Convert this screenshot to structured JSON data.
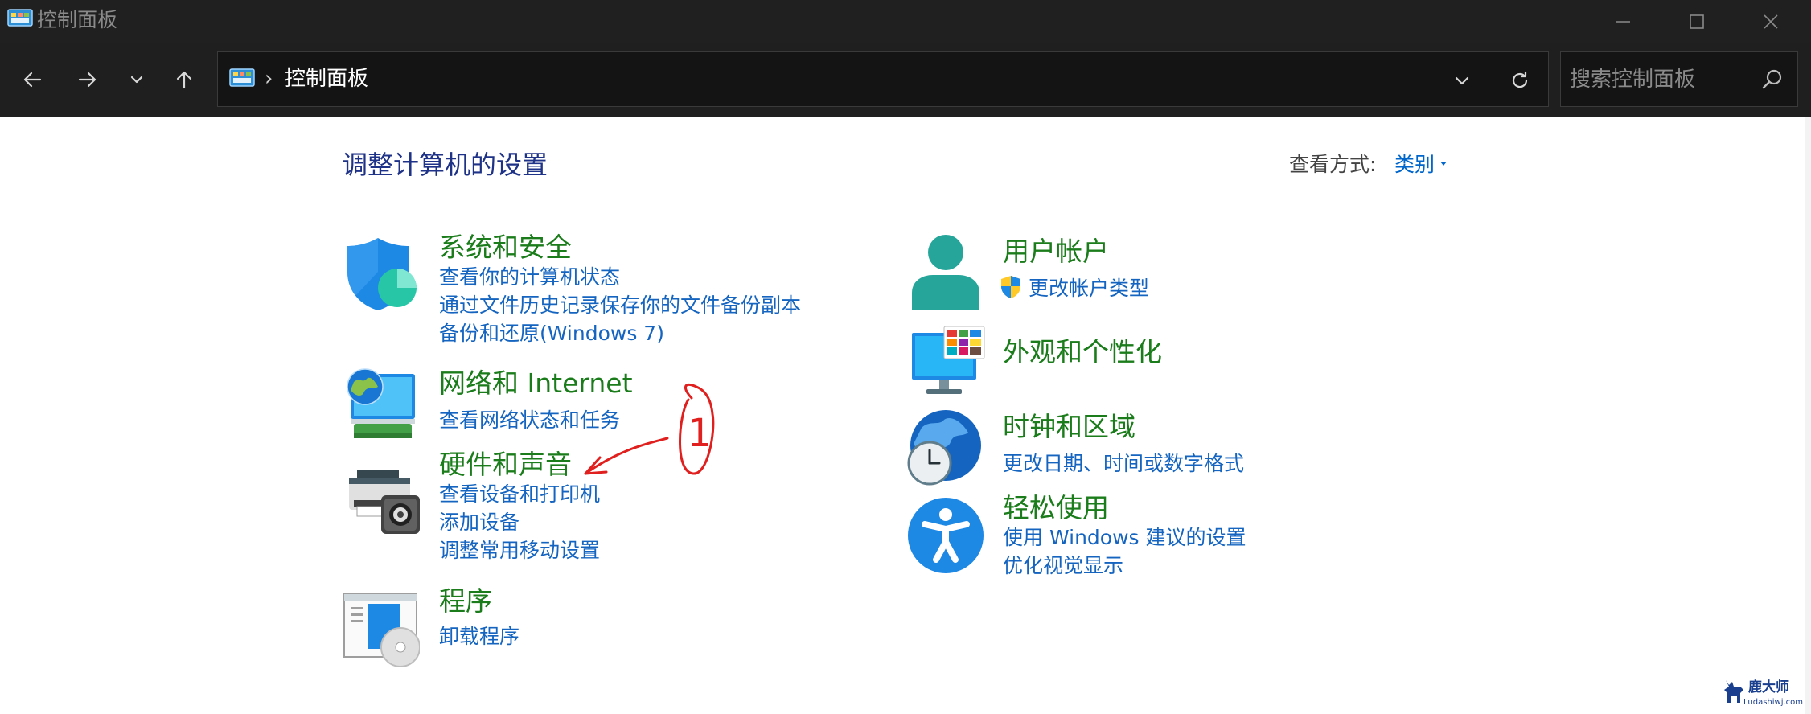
{
  "window": {
    "title": "控制面板"
  },
  "toolbar": {
    "breadcrumb_separator": "›",
    "address": "控制面板",
    "search_placeholder": "搜索控制面板"
  },
  "main": {
    "title": "调整计算机的设置",
    "view_by_label": "查看方式:",
    "view_by_value": "类别"
  },
  "categories_left": [
    {
      "title": "系统和安全",
      "icon": "shield-icon",
      "links": [
        "查看你的计算机状态",
        "通过文件历史记录保存你的文件备份副本",
        "备份和还原(Windows 7)"
      ]
    },
    {
      "title": "网络和 Internet",
      "icon": "network-icon",
      "links": [
        "查看网络状态和任务"
      ]
    },
    {
      "title": "硬件和声音",
      "icon": "printer-icon",
      "links": [
        "查看设备和打印机",
        "添加设备",
        "调整常用移动设置"
      ]
    },
    {
      "title": "程序",
      "icon": "programs-icon",
      "links": [
        "卸载程序"
      ]
    }
  ],
  "categories_right": [
    {
      "title": "用户帐户",
      "icon": "user-icon",
      "links": [
        "更改帐户类型"
      ]
    },
    {
      "title": "外观和个性化",
      "icon": "appearance-icon",
      "links": []
    },
    {
      "title": "时钟和区域",
      "icon": "clock-globe-icon",
      "links": [
        "更改日期、时间或数字格式"
      ]
    },
    {
      "title": "轻松使用",
      "icon": "accessibility-icon",
      "links": [
        "使用 Windows 建议的设置",
        "优化视觉显示"
      ]
    }
  ],
  "annotation": {
    "label": "1",
    "color": "#e0201e"
  },
  "watermark": {
    "line1": "鹿大师",
    "line2": "Ludashiwj.com"
  },
  "colors": {
    "title_green": "#1a7c1a",
    "link_blue": "#1565c0",
    "heading_blue": "#1e3287",
    "titlebar": "#202020",
    "toolbar": "#1f1f1f"
  }
}
